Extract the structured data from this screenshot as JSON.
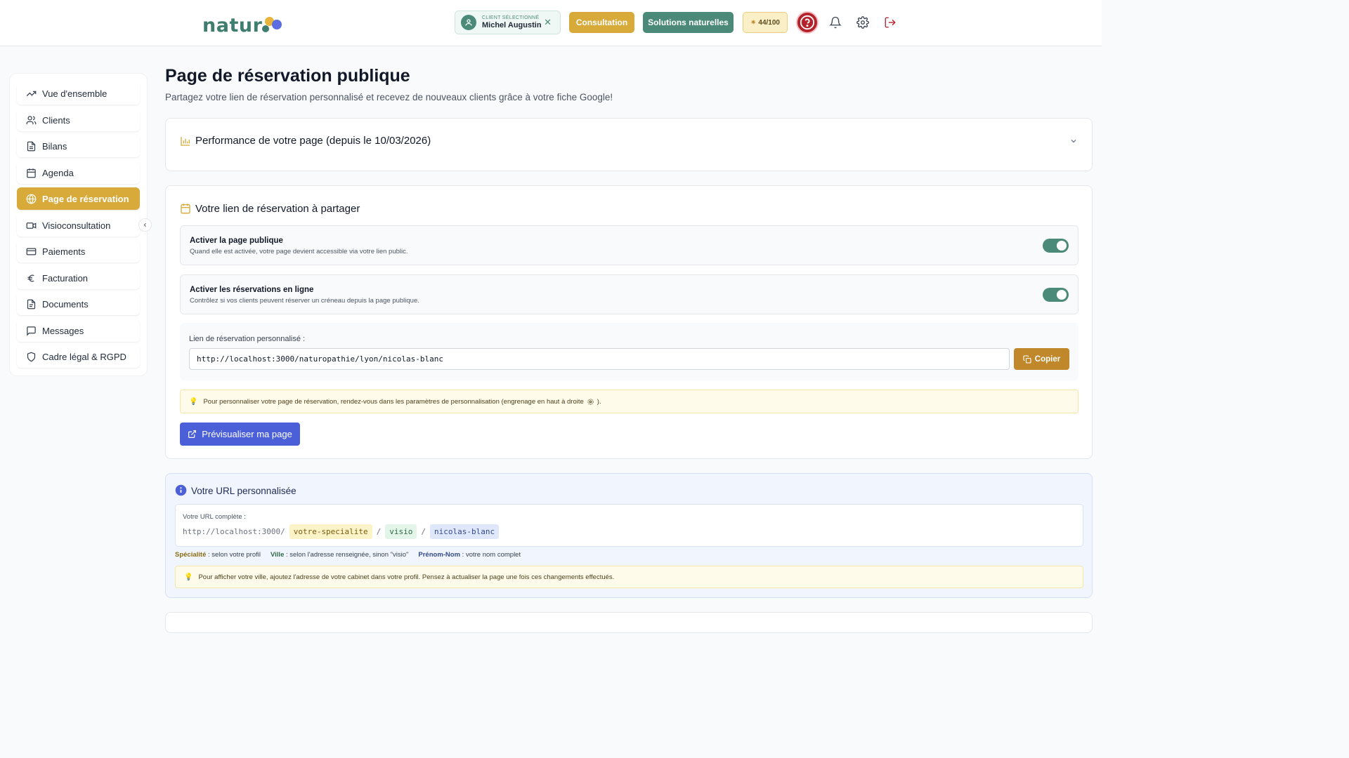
{
  "header": {
    "logo_text": "natur",
    "client": {
      "label": "CLIENT SÉLECTIONNÉ",
      "name": "Michel Augustin"
    },
    "buttons": {
      "consultation": "Consultation",
      "solutions": "Solutions naturelles"
    },
    "credits": "44/100"
  },
  "sidebar": {
    "items": [
      {
        "label": "Vue d'ensemble",
        "icon": "trending-up-icon"
      },
      {
        "label": "Clients",
        "icon": "users-icon"
      },
      {
        "label": "Bilans",
        "icon": "file-text-icon"
      },
      {
        "label": "Agenda",
        "icon": "calendar-icon"
      },
      {
        "label": "Page de réservation",
        "icon": "globe-icon",
        "active": true
      },
      {
        "label": "Visioconsultation",
        "icon": "video-icon"
      },
      {
        "label": "Paiements",
        "icon": "credit-card-icon"
      },
      {
        "label": "Facturation",
        "icon": "euro-icon"
      },
      {
        "label": "Documents",
        "icon": "document-icon"
      },
      {
        "label": "Messages",
        "icon": "message-icon"
      },
      {
        "label": "Cadre légal & RGPD",
        "icon": "shield-icon"
      }
    ]
  },
  "main": {
    "title": "Page de réservation publique",
    "subtitle": "Partagez votre lien de réservation personnalisé et recevez de nouveaux clients grâce à votre fiche Google!",
    "performance": {
      "title": "Performance de votre page (depuis le 10/03/2026)"
    },
    "share": {
      "title": "Votre lien de réservation à partager",
      "toggles": [
        {
          "title": "Activer la page publique",
          "desc": "Quand elle est activée, votre page devient accessible via votre lien public.",
          "on": true
        },
        {
          "title": "Activer les réservations en ligne",
          "desc": "Contrôlez si vos clients peuvent réserver un créneau depuis la page publique.",
          "on": true
        }
      ],
      "link_label": "Lien de réservation personnalisé :",
      "link_value": "http://localhost:3000/naturopathie/lyon/nicolas-blanc",
      "copy_label": "Copier",
      "tip_before": "Pour personnaliser votre page de réservation, rendez-vous dans les paramètres de personnalisation (engrenage en haut à droite",
      "tip_after": ").",
      "preview_label": "Prévisualiser ma page"
    },
    "url_info": {
      "title": "Votre URL personnalisée",
      "full_label": "Votre URL complète :",
      "base": "http://localhost:3000/",
      "specialty": "votre-specialite",
      "city": "visio",
      "name": "nicolas-blanc",
      "sep": "/",
      "legend": [
        {
          "key": "Spécialité",
          "text": " : selon votre profil",
          "color": "#8a6a12"
        },
        {
          "key": "Ville",
          "text": " : selon l'adresse renseignée, sinon \"visio\"",
          "color": "#2f6a45"
        },
        {
          "key": "Prénom-Nom",
          "text": " : votre nom complet",
          "color": "#344a8c"
        }
      ],
      "tip": "Pour afficher votre ville, ajoutez l'adresse de votre cabinet dans votre profil. Pensez à actualiser la page une fois ces changements effectués."
    }
  },
  "colors": {
    "gold": "#d8aa3a",
    "green": "#4b8a78",
    "blue": "#4a5fd8",
    "red": "#b4232c"
  }
}
